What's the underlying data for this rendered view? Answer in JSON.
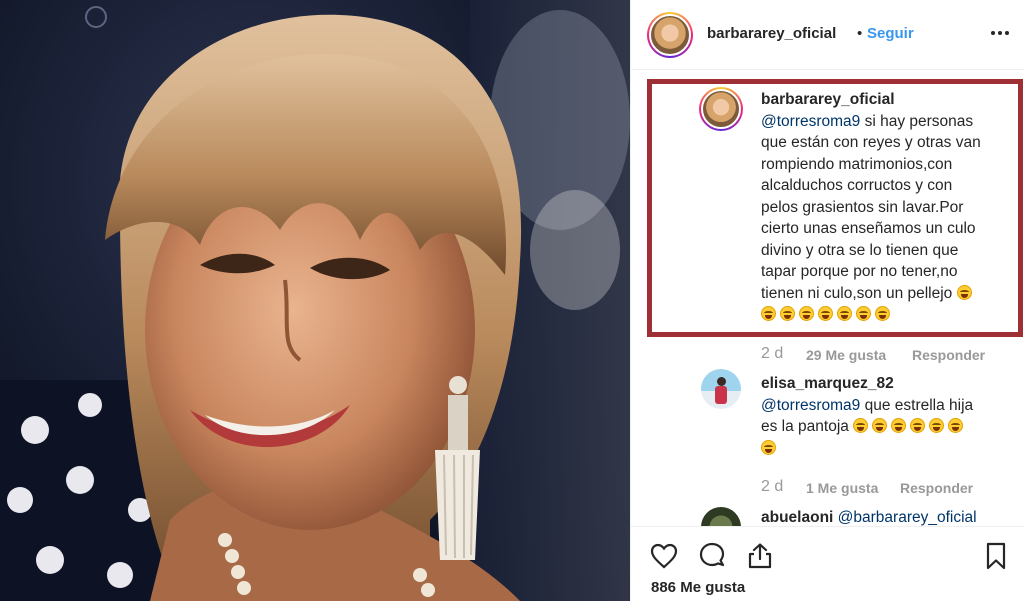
{
  "header": {
    "username": "barbararey_oficial",
    "separator": "•",
    "follow_label": "Seguir",
    "more_icon": "more-horizontal-icon"
  },
  "comments": [
    {
      "username": "barbararey_oficial",
      "mention": "@torresroma9",
      "lines": [
        " si hay personas",
        "que están con reyes y otras van",
        "rompiendo matrimonios,con",
        "alcalduchos corructos y con",
        "pelos grasientos sin lavar.Por",
        "cierto unas enseñamos un culo",
        "divino y otra se lo tienen que",
        "tapar porque por no tener,no",
        "tienen ni culo,son un pellejo"
      ],
      "emoji": "laughing-crying-emoji",
      "time": "2 d",
      "likes": "29 Me gusta",
      "reply": "Responder"
    },
    {
      "username": "elisa_marquez_82",
      "mention": "@torresroma9",
      "lines": [
        " que estrella hija",
        "es la pantoja"
      ],
      "emoji": "laughing-crying-emoji",
      "time": "2 d",
      "likes": "1 Me gusta",
      "reply": "Responder"
    },
    {
      "username": "abuelaoni",
      "mention": "@barbararey_oficial"
    }
  ],
  "actions": {
    "like_icon": "heart-icon",
    "comment_icon": "comment-bubble-icon",
    "share_icon": "share-icon",
    "save_icon": "bookmark-icon",
    "likes_count": "886 Me gusta"
  },
  "colors": {
    "accent": "#3897f0",
    "highlight_border": "#9e2f35",
    "mention": "#003569"
  }
}
